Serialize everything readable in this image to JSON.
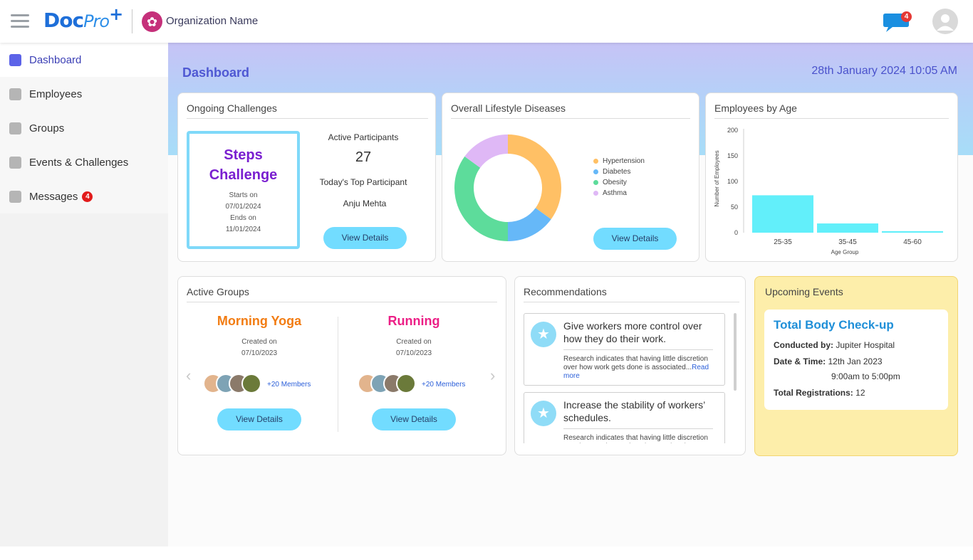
{
  "header": {
    "logo_main": "Doc",
    "logo_pro": "Pro",
    "logo_plus": "+",
    "org_name": "Organization Name",
    "chat_badge": "4"
  },
  "sidebar": {
    "items": [
      {
        "label": "Dashboard",
        "active": true
      },
      {
        "label": "Employees"
      },
      {
        "label": "Groups"
      },
      {
        "label": "Events & Challenges"
      },
      {
        "label": "Messages",
        "badge": "4"
      }
    ]
  },
  "page": {
    "title": "Dashboard",
    "datetime": "28th January 2024 10:05 AM"
  },
  "challenges": {
    "title": "Ongoing Challenges",
    "name_line1": "Steps",
    "name_line2": "Challenge",
    "starts_label": "Starts on",
    "starts_date": "07/01/2024",
    "ends_label": "Ends on",
    "ends_date": "11/01/2024",
    "active_label": "Active Participants",
    "active_count": "27",
    "top_label": "Today's Top Participant",
    "top_name": "Anju Mehta",
    "button": "View Details"
  },
  "diseases": {
    "title": "Overall Lifestyle Diseases",
    "button": "View Details"
  },
  "age_chart": {
    "title": "Employees by Age"
  },
  "chart_data": [
    {
      "type": "pie",
      "categories": [
        "Hypertension",
        "Diabetes",
        "Obesity",
        "Asthma"
      ],
      "values": [
        35,
        15,
        35,
        15
      ],
      "colors": [
        "#ffc065",
        "#66b8f8",
        "#5ddc9b",
        "#dfb8f6"
      ],
      "title": "Overall Lifestyle Diseases",
      "legend": "right"
    },
    {
      "type": "bar",
      "categories": [
        "25-35",
        "35-45",
        "45-60"
      ],
      "values": [
        73,
        18,
        3
      ],
      "color": "#62effa",
      "title": "Employees by Age",
      "xlabel": "Age Group",
      "ylabel": "Number of Employees",
      "ylim": [
        0,
        200
      ],
      "yticks": [
        "200",
        "150",
        "100",
        "50",
        "0"
      ]
    }
  ],
  "groups": {
    "title": "Active Groups",
    "items": [
      {
        "name": "Morning Yoga",
        "color": "#f27c12",
        "created_label": "Created on",
        "created_date": "07/10/2023",
        "members": "+20 Members",
        "button": "View Details"
      },
      {
        "name": "Running",
        "color": "#ec1f86",
        "created_label": "Created on",
        "created_date": "07/10/2023",
        "members": "+20 Members",
        "button": "View Details"
      }
    ],
    "prev_icon": "‹",
    "next_icon": "›"
  },
  "recommendations": {
    "title": "Recommendations",
    "items": [
      {
        "title": "Give workers more control over how they do their work.",
        "body": "Research indicates that having little discretion over how work gets done is associated...",
        "more": "Read more"
      },
      {
        "title": "Increase the stability of workers’ schedules.",
        "body": "Research indicates that having little discretion over how work gets done is associated..."
      }
    ]
  },
  "events": {
    "title": "Upcoming Events",
    "name": "Total Body Check-up",
    "conducted_label": "Conducted by:",
    "conducted_value": "Jupiter Hospital",
    "datetime_label": "Date & Time:",
    "date_value": "12th Jan 2023",
    "time_value": "9:00am to 5:00pm",
    "reg_label": "Total Registrations:",
    "reg_value": "12"
  }
}
